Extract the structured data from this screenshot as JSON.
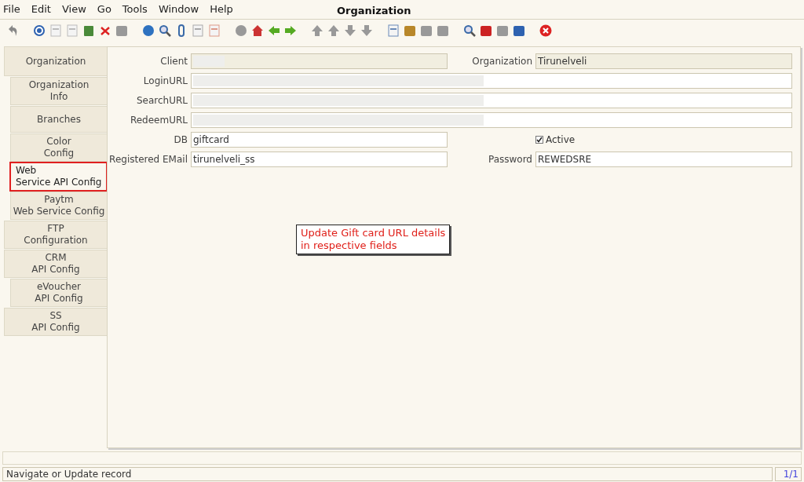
{
  "menu": [
    "File",
    "Edit",
    "View",
    "Go",
    "Tools",
    "Window",
    "Help"
  ],
  "window": {
    "title": "Organization"
  },
  "tabs": [
    {
      "label": "Organization",
      "selected": false,
      "children": [
        {
          "label": "Organization\nInfo",
          "selected": false
        },
        {
          "label": "Branches",
          "selected": false
        },
        {
          "label": "Color\nConfig",
          "selected": false
        },
        {
          "label": "Web\nService API Config",
          "selected": true,
          "highlighted": true
        },
        {
          "label": "Paytm\nWeb Service Config",
          "selected": false
        }
      ]
    },
    {
      "label": "FTP\nConfiguration",
      "selected": false
    },
    {
      "label": "CRM\nAPI Config",
      "selected": false,
      "children": [
        {
          "label": "eVoucher\nAPI Config",
          "selected": false
        }
      ]
    },
    {
      "label": "SS\nAPI Config",
      "selected": false
    }
  ],
  "form": {
    "rows": [
      [
        {
          "label": "Client",
          "readonly": true,
          "redacted": true
        },
        {
          "label": "Organization",
          "value": "Tirunelveli",
          "readonly": true
        }
      ],
      [
        {
          "label": "LoginURL",
          "readonly": false,
          "redacted": true
        }
      ],
      [
        {
          "label": "SearchURL",
          "readonly": false,
          "redacted": true
        }
      ],
      [
        {
          "label": "RedeemURL",
          "readonly": false,
          "redacted": true
        }
      ],
      [
        {
          "label": "DB",
          "value": "giftcard",
          "readonly": false
        },
        {
          "kind": "checkbox",
          "label": "Active",
          "checked": true
        }
      ],
      [
        {
          "label": "Registered EMail",
          "value": "tirunelveli_ss",
          "readonly": false
        },
        {
          "label": "Password",
          "value": "REWEDSRE",
          "readonly": false
        }
      ]
    ]
  },
  "callout": {
    "text": "Update Gift card URL details\nin respective fields"
  },
  "status_bar": {
    "message": "Navigate or Update record",
    "record": "1/1"
  }
}
